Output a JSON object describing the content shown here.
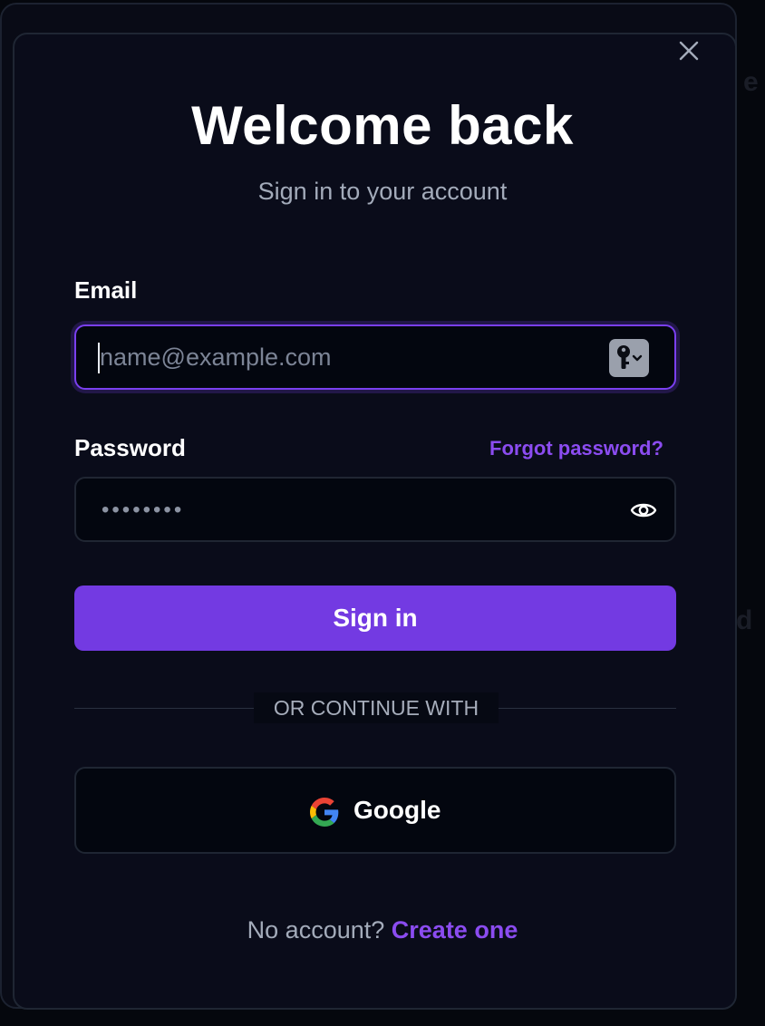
{
  "dialog": {
    "title": "Welcome back",
    "subtitle": "Sign in to your account",
    "close_icon": "close-icon"
  },
  "email": {
    "label": "Email",
    "placeholder": "name@example.com",
    "value": "",
    "autofill_icon": "key-icon"
  },
  "password": {
    "label": "Password",
    "forgot_link": "Forgot password?",
    "masked_value": "••••••••",
    "visibility_icon": "eye-icon"
  },
  "actions": {
    "signin_label": "Sign in",
    "divider_text": "OR CONTINUE WITH",
    "google_label": "Google",
    "google_icon": "google-icon"
  },
  "footer": {
    "prompt": "No account?",
    "create_link": "Create one"
  },
  "colors": {
    "accent": "#733ae2",
    "link": "#8b4cf0",
    "background": "#0a0c1a",
    "input_bg": "#03060f"
  }
}
